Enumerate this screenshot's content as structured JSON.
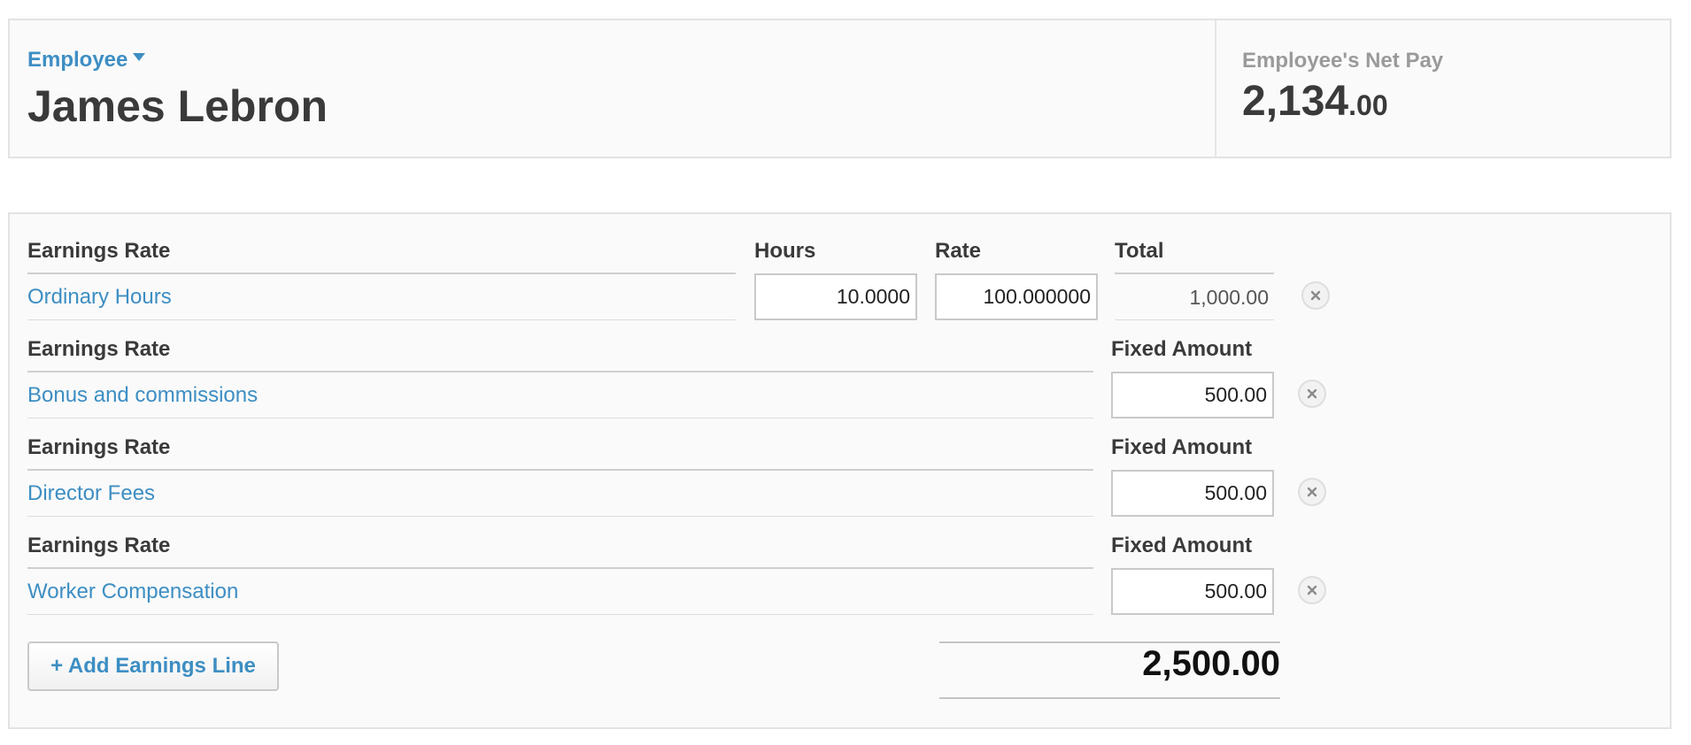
{
  "employee": {
    "dropdown_label": "Employee",
    "name": "James Lebron",
    "net_pay_label": "Employee's Net Pay",
    "net_pay_whole": "2,134",
    "net_pay_cents": ".00"
  },
  "earnings": {
    "lines": [
      {
        "rate_header": "Earnings Rate",
        "hours_header": "Hours",
        "rate_col_header": "Rate",
        "total_header": "Total",
        "name": "Ordinary Hours",
        "hours": "10.0000",
        "rate": "100.000000",
        "total": "1,000.00"
      },
      {
        "rate_header": "Earnings Rate",
        "amount_header": "Fixed Amount",
        "name": "Bonus and commissions",
        "amount": "500.00"
      },
      {
        "rate_header": "Earnings Rate",
        "amount_header": "Fixed Amount",
        "name": "Director Fees",
        "amount": "500.00"
      },
      {
        "rate_header": "Earnings Rate",
        "amount_header": "Fixed Amount",
        "name": "Worker Compensation",
        "amount": "500.00"
      }
    ],
    "add_button_label": "+ Add Earnings Line",
    "grand_total": "2,500.00"
  },
  "icons": {
    "remove": "close-circle-icon",
    "dropdown": "caret-down-icon"
  },
  "colors": {
    "link": "#3d8ec3",
    "panel_bg": "#fafafa"
  }
}
